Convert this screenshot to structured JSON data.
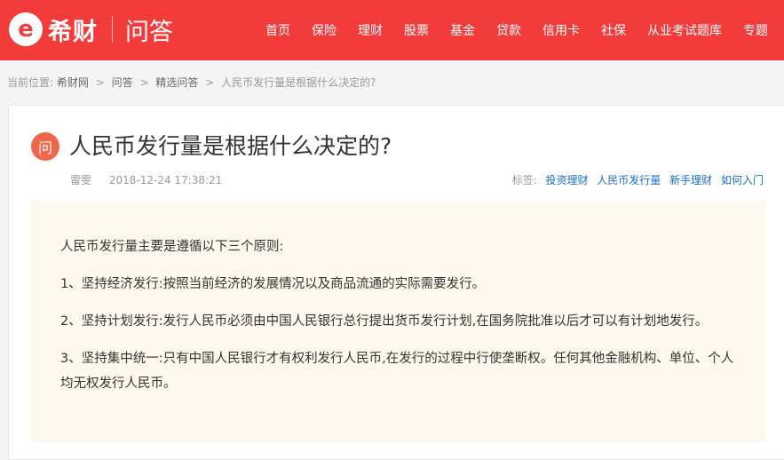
{
  "header": {
    "logo_mark": "e",
    "logo_text": "希财",
    "section": "问答",
    "nav": [
      "首页",
      "保险",
      "理财",
      "股票",
      "基金",
      "贷款",
      "信用卡",
      "社保",
      "从业考试题库",
      "专题"
    ]
  },
  "breadcrumb": {
    "prefix": "当前位置:",
    "items": [
      "希财网",
      "问答",
      "精选问答"
    ],
    "current": "人民币发行量是根据什么决定的?",
    "separator": ">"
  },
  "article": {
    "badge": "问",
    "title": "人民币发行量是根据什么决定的?",
    "author": "雷雯",
    "date": "2018-12-24 17:38:21",
    "tags_label": "标签:",
    "tags": [
      "投资理财",
      "人民币发行量",
      "新手理财",
      "如何入门"
    ],
    "paragraphs": [
      "人民币发行量主要是遵循以下三个原则:",
      "1、坚持经济发行:按照当前经济的发展情况以及商品流通的实际需要发行。",
      "2、坚持计划发行:发行人民币必须由中国人民银行总行提出货币发行计划,在国务院批准以后才可以有计划地发行。",
      "3、坚持集中统一:只有中国人民银行才有权利发行人民币,在发行的过程中行使垄断权。任何其他金融机构、单位、个人均无权发行人民币。"
    ]
  },
  "colors": {
    "header_bg": "#f23c3c",
    "badge_bg": "#f0664a",
    "tag_link": "#1a6fc9",
    "content_bg": "#fdf8ee"
  }
}
